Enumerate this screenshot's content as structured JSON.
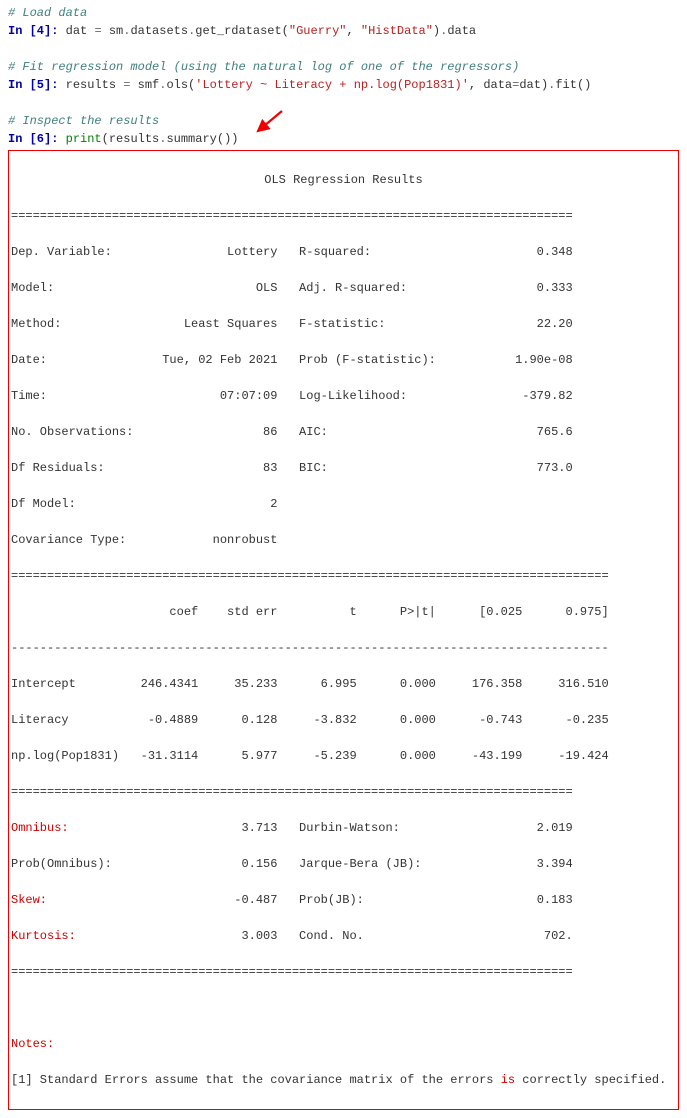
{
  "cells": {
    "c1_comment": "# Load data",
    "c1_prompt": "In [4]:",
    "c1_code_pre": " dat ",
    "c1_eq": "=",
    "c1_rest": " sm",
    "c1_dot1": ".",
    "c1_m1": "datasets",
    "c1_dot2": ".",
    "c1_m2": "get_rdataset(",
    "c1_s1": "\"Guerry\"",
    "c1_comma": ", ",
    "c1_s2": "\"HistData\"",
    "c1_close": ")",
    "c1_dot3": ".",
    "c1_m3": "data",
    "c2_comment": "# Fit regression model (using the natural log of one of the regressors)",
    "c2_prompt": "In [5]:",
    "c2_pre": " results ",
    "c2_eq": "=",
    "c2_rest": " smf",
    "c2_dot1": ".",
    "c2_m1": "ols(",
    "c2_s1": "'Lottery ~ Literacy + np.log(Pop1831)'",
    "c2_kw": ", data",
    "c2_eq2": "=",
    "c2_arg": "dat)",
    "c2_dot2": ".",
    "c2_m2": "fit()",
    "c3_comment": "# Inspect the results",
    "c3_prompt": "In [6]:",
    "c3_pre": " ",
    "c3_builtin": "print",
    "c3_open": "(results",
    "c3_dot1": ".",
    "c3_m1": "summary())"
  },
  "results": {
    "title": "OLS Regression Results",
    "hr_eq": "==============================================================================",
    "line01": "Dep. Variable:                Lottery   R-squared:                       0.348",
    "line02": "Model:                            OLS   Adj. R-squared:                  0.333",
    "line03": "Method:                 Least Squares   F-statistic:                     22.20",
    "line04": "Date:                Tue, 02 Feb 2021   Prob (F-statistic):           1.90e-08",
    "line05": "Time:                        07:07:09   Log-Likelihood:                -379.82",
    "line06": "No. Observations:                  86   AIC:                             765.6",
    "line07": "Df Residuals:                      83   BIC:                             773.0",
    "line08": "Df Model:                           2",
    "line09": "Covariance Type:            nonrobust",
    "hr_eq2": "===================================================================================",
    "coefhdr": "                      coef    std err          t      P>|t|      [0.025      0.975]",
    "hr_dash": "-----------------------------------------------------------------------------------",
    "row1": "Intercept         246.4341     35.233      6.995      0.000     176.358     316.510",
    "row2": "Literacy           -0.4889      0.128     -3.832      0.000      -0.743      -0.235",
    "row3": "np.log(Pop1831)   -31.3114      5.977     -5.239      0.000     -43.199     -19.424",
    "hr_eq3": "==============================================================================",
    "diag1_k": "Omnibus:",
    "diag1_rest": "                        3.713   Durbin-Watson:                   2.019",
    "diag2": "Prob(Omnibus):                  0.156   Jarque-Bera (JB):                3.394",
    "diag3_k": "Skew:",
    "diag3_rest": "                          -0.487   Prob(JB):                        0.183",
    "diag4_k": "Kurtosis:",
    "diag4_rest": "                       3.003   Cond. No.                         702.",
    "hr_eq4": "==============================================================================",
    "notes_label": "Notes:",
    "notes_pre": "[1] Standard Errors assume that the covariance matrix of the errors ",
    "notes_is": "is",
    "notes_post": " correctly specified."
  },
  "chart_data": {
    "type": "table",
    "title": "OLS Regression Results",
    "dep_variable": "Lottery",
    "model": "OLS",
    "method": "Least Squares",
    "date": "Tue, 02 Feb 2021",
    "time": "07:07:09",
    "n_obs": 86,
    "df_residuals": 83,
    "df_model": 2,
    "covariance_type": "nonrobust",
    "r_squared": 0.348,
    "adj_r_squared": 0.333,
    "f_statistic": 22.2,
    "prob_f_statistic": 1.9e-08,
    "log_likelihood": -379.82,
    "aic": 765.6,
    "bic": 773.0,
    "coefficients": [
      {
        "name": "Intercept",
        "coef": 246.4341,
        "std_err": 35.233,
        "t": 6.995,
        "p": 0.0,
        "ci_low": 176.358,
        "ci_high": 316.51
      },
      {
        "name": "Literacy",
        "coef": -0.4889,
        "std_err": 0.128,
        "t": -3.832,
        "p": 0.0,
        "ci_low": -0.743,
        "ci_high": -0.235
      },
      {
        "name": "np.log(Pop1831)",
        "coef": -31.3114,
        "std_err": 5.977,
        "t": -5.239,
        "p": 0.0,
        "ci_low": -43.199,
        "ci_high": -19.424
      }
    ],
    "omnibus": 3.713,
    "prob_omnibus": 0.156,
    "skew": -0.487,
    "kurtosis": 3.003,
    "durbin_watson": 2.019,
    "jarque_bera": 3.394,
    "prob_jb": 0.183,
    "cond_no": 702.0,
    "notes": [
      "Standard Errors assume that the covariance matrix of the errors is correctly specified."
    ]
  }
}
